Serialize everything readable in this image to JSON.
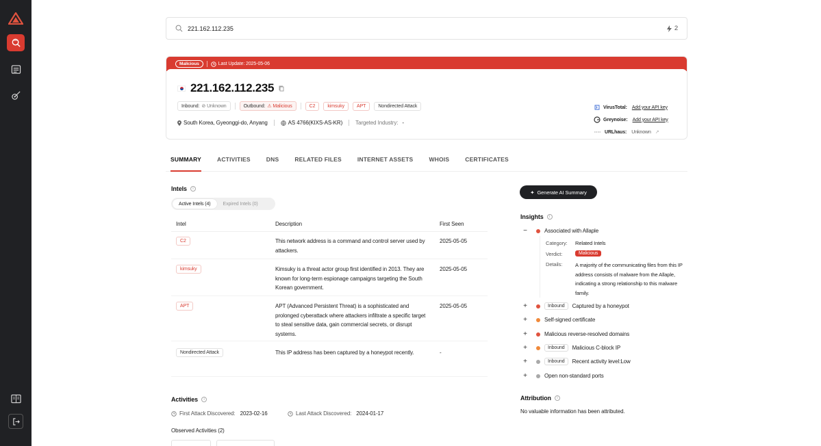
{
  "search": {
    "value": "221.162.112.235",
    "result_count": "2"
  },
  "header": {
    "verdict": "Malicious",
    "last_update": "Last Update: 2025-05-06",
    "ip": "221.162.112.235",
    "inbound_label": "Inbound:",
    "inbound_value": "Unknown",
    "outbound_label": "Outbound:",
    "outbound_value": "Malicious",
    "tags": [
      "C2",
      "kimsuky",
      "APT",
      "Nondirected Attack"
    ],
    "location": "South Korea, Gyeonggi-do, Anyang",
    "asn": "AS 4766(KIXS-AS-KR)",
    "industry_label": "Targeted Industry:",
    "industry_value": "-"
  },
  "api": {
    "virustotal_label": "VirusTotal:",
    "virustotal_link": "Add your API key",
    "greynoise_label": "Greynoise:",
    "greynoise_link": "Add your API key",
    "urlhaus_label": "URLhaus:",
    "urlhaus_value": "Unknown"
  },
  "tabs": [
    "SUMMARY",
    "ACTIVITIES",
    "DNS",
    "RELATED FILES",
    "INTERNET ASSETS",
    "WHOIS",
    "CERTIFICATES"
  ],
  "intels": {
    "title": "Intels",
    "active_label": "Active Intels (4)",
    "expired_label": "Expired Intels (0)",
    "col_intel": "Intel",
    "col_desc": "Description",
    "col_seen": "First Seen",
    "rows": [
      {
        "intel": "C2",
        "desc": "This network address is a command and control server used by attackers.",
        "seen": "2025-05-05"
      },
      {
        "intel": "kimsuky",
        "desc": "Kimsuky is a threat actor group first identified in 2013. They are known for long-term espionage campaigns targeting the South Korean government.",
        "seen": "2025-05-05"
      },
      {
        "intel": "APT",
        "desc": "APT (Advanced Persistent Threat) is a sophisticated and prolonged cyberattack where attackers infiltrate a specific target to steal sensitive data, gain commercial secrets, or disrupt systems.",
        "seen": "2025-05-05"
      },
      {
        "intel": "Nondirected Attack",
        "desc": "This IP address has been captured by a honeypot recently.",
        "seen": "-"
      }
    ]
  },
  "activities": {
    "title": "Activities",
    "first_label": "First Attack Discovered:",
    "first_value": "2023-02-16",
    "last_label": "Last Attack Discovered:",
    "last_value": "2024-01-17",
    "observed_label": "Observed Activities (2)"
  },
  "ai": {
    "button": "Generate AI Summary"
  },
  "insights": {
    "title": "Insights",
    "items": [
      {
        "label": "Associated with Allaple",
        "inbound": "",
        "color": "#e0533f",
        "toggle": "−"
      },
      {
        "label": "Captured by a honeypot",
        "inbound": "Inbound",
        "color": "#e0533f",
        "toggle": "+"
      },
      {
        "label": "Self-signed certificate",
        "inbound": "",
        "color": "#f0893a",
        "toggle": "+"
      },
      {
        "label": "Malicious reverse-resolved domains",
        "inbound": "",
        "color": "#e0533f",
        "toggle": "+"
      },
      {
        "label": "Malicious C-block IP",
        "inbound": "Inbound",
        "color": "#f0893a",
        "toggle": "+"
      },
      {
        "label": "Recent activity level:Low",
        "inbound": "Inbound",
        "color": "#a9a9a9",
        "toggle": "+"
      },
      {
        "label": "Open non-standard ports",
        "inbound": "",
        "color": "#a9a9a9",
        "toggle": "+"
      }
    ],
    "detail": {
      "category_label": "Category:",
      "category_value": "Related Intels",
      "verdict_label": "Verdict:",
      "verdict_value": "Malicious",
      "details_label": "Details:",
      "details_value": "A majority of the communicating files from this IP address consists of malware from the Allaple, indicating a strong relationship to this malware family."
    }
  },
  "attribution": {
    "title": "Attribution",
    "text": "No valuable information has been attributed."
  },
  "colors": {
    "accent": "#d93b30",
    "sidebar": "#202124"
  }
}
